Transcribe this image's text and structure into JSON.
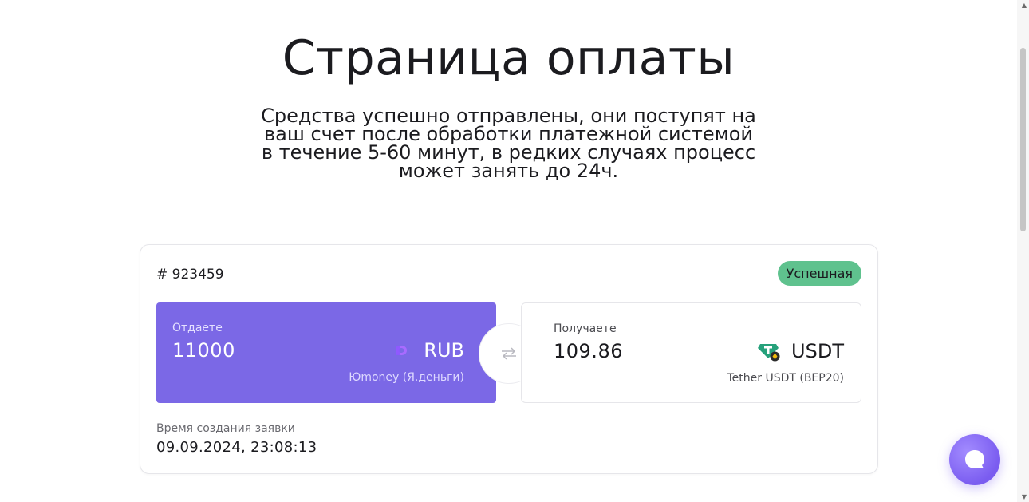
{
  "page": {
    "title": "Страница оплаты",
    "subtitle": "Средства успешно отправлены, они поступят на ваш счет после обработки платежной системой в течение 5-60 минут, в редких случаях процесс может занять до 24ч."
  },
  "order": {
    "id": "# 923459",
    "status": "Успешная",
    "status_color": "#5fc28e",
    "give": {
      "label": "Отдаете",
      "amount": "11000",
      "currency": "RUB",
      "method": "Юmoney (Я.деньги)",
      "icon": "yoomoney-icon",
      "bg_color": "#7b68e6"
    },
    "receive": {
      "label": "Получаете",
      "amount": "109.86",
      "currency": "USDT",
      "method": "Tether USDT (BEP20)",
      "icon": "tether-icon"
    },
    "swap_icon": "arrows-exchange-icon",
    "created": {
      "label": "Время создания заявки",
      "value": "09.09.2024, 23:08:13"
    }
  },
  "widgets": {
    "chat_icon": "chat-bubble-icon",
    "chat_color": "#7a5cf0"
  }
}
